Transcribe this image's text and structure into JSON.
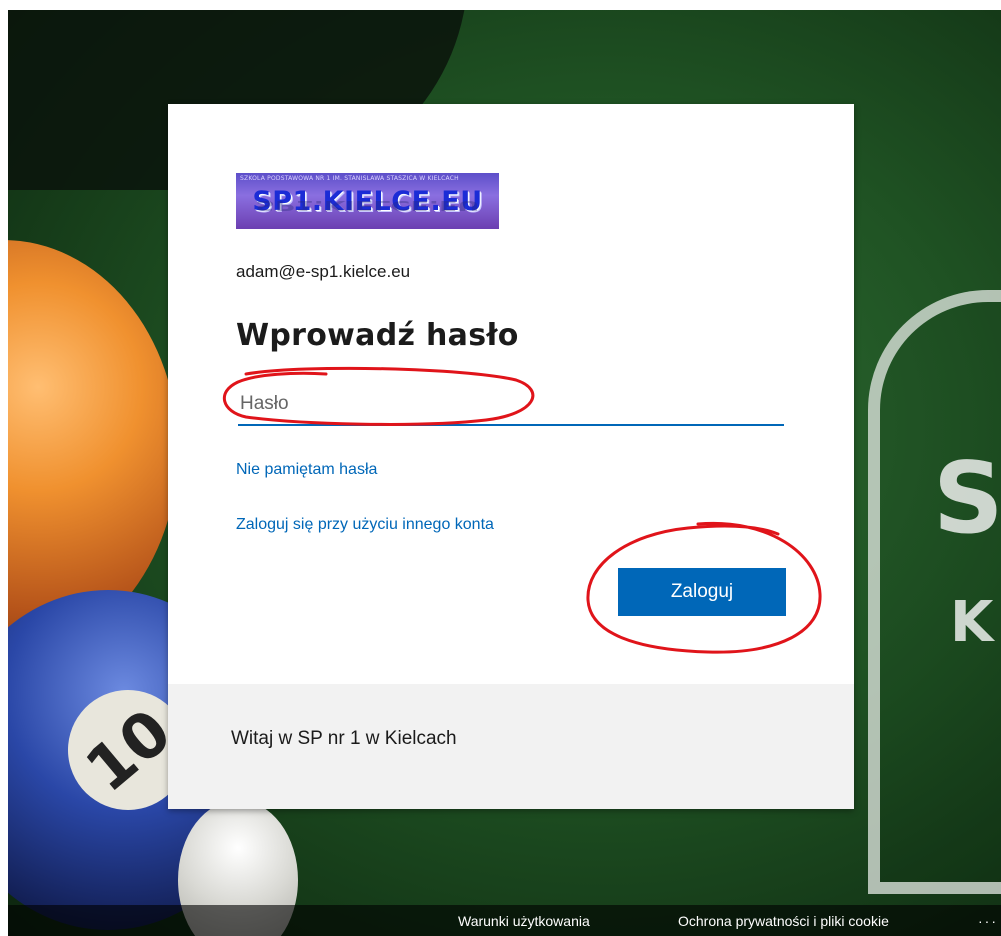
{
  "logo": {
    "tiny_text": "SZKOLA PODSTAWOWA NR 1 IM. STANISLAWA STASZICA W KIELCACH",
    "main_text": "SP1.KIELCE.EU"
  },
  "signin": {
    "email": "adam@e-sp1.kielce.eu",
    "title": "Wprowadź hasło",
    "password_placeholder": "Hasło",
    "forgot_link": "Nie pamiętam hasła",
    "other_account_link": "Zaloguj się przy użyciu innego konta",
    "submit_label": "Zaloguj"
  },
  "card_footer": {
    "text": "Witaj w SP nr 1 w Kielcach"
  },
  "page_footer": {
    "terms": "Warunki użytkowania",
    "privacy": "Ochrona prywatności i pliki cookie",
    "more": "···"
  },
  "background": {
    "ball_number": "10",
    "shield_text_line1": "S",
    "shield_text_line2": "K"
  },
  "colors": {
    "accent": "#0067b8",
    "annotation": "#e0141a"
  }
}
